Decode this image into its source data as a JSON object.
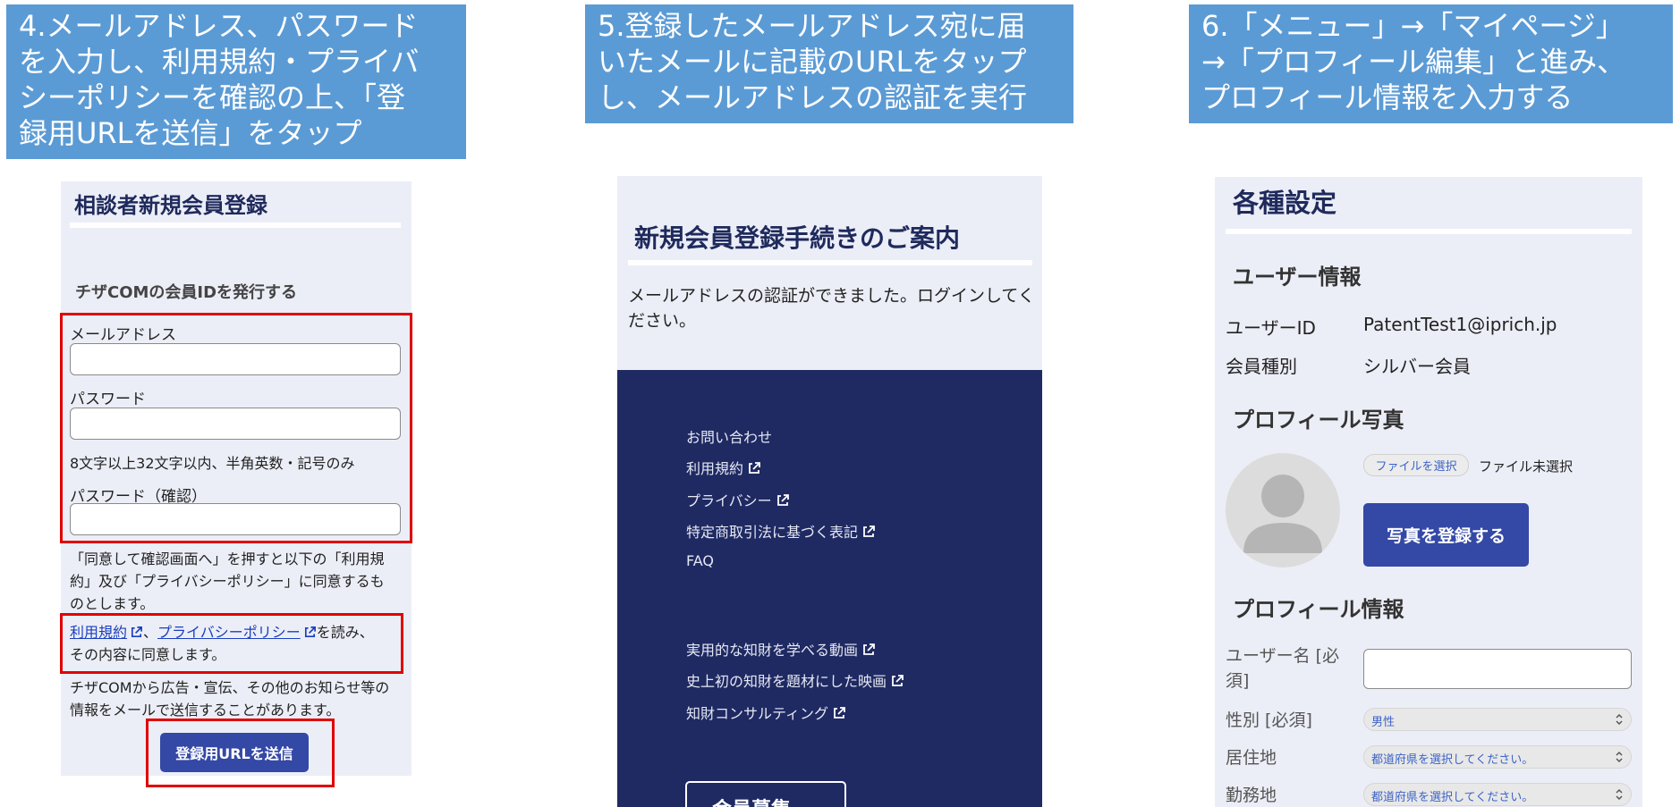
{
  "banners": {
    "step4": [
      "4.メールアドレス、パスワード",
      "を入力し、利用規約・プライバ",
      "シーポリシーを確認の上、「登",
      "録用URLを送信」をタップ"
    ],
    "step5": [
      "5.登録したメールアドレス宛に届",
      "いたメールに記載のURLをタップ",
      "し、メールアドレスの認証を実行"
    ],
    "step6": [
      "6.「メニュー」→「マイページ」",
      "→「プロフィール編集」と進み、",
      "プロフィール情報を入力する"
    ]
  },
  "register": {
    "title": "相談者新規会員登録",
    "subtitle": "チザCOMの会員IDを発行する",
    "email_label": "メールアドレス",
    "password_label": "パスワード",
    "password_hint": "8文字以上32文字以内、半角英数・記号のみ",
    "password_confirm_label": "パスワード（確認）",
    "consent_lines": [
      "「同意して確認画面へ」を押すと以下の「利用規",
      "約」及び「プライバシーポリシー」に同意するも",
      "のとします。"
    ],
    "terms_link": "利用規約",
    "separator": "、",
    "privacy_link": "プライバシーポリシー",
    "agree_tail": "を読み、",
    "agree_line2": "その内容に同意します。",
    "ads_lines": [
      "チザCOMから広告・宣伝、その他のお知らせ等の",
      "情報をメールで送信することがあります。"
    ],
    "submit_label": "登録用URLを送信"
  },
  "verify": {
    "title": "新規会員登録手続きのご案内",
    "message": "メールアドレスの認証ができました。ログインしてください。",
    "footer_links": [
      {
        "label": "お問い合わせ",
        "external": false
      },
      {
        "label": "利用規約",
        "external": true
      },
      {
        "label": "プライバシー",
        "external": true
      },
      {
        "label": "特定商取引法に基づく表記",
        "external": true
      },
      {
        "label": "FAQ",
        "external": false
      }
    ],
    "footer_links2": [
      {
        "label": "実用的な知財を学べる動画",
        "external": true
      },
      {
        "label": "史上初の知財を題材にした映画",
        "external": true
      },
      {
        "label": "知財コンサルティング",
        "external": true
      }
    ],
    "partial_button": "会員募集"
  },
  "settings": {
    "title": "各種設定",
    "user_section": "ユーザー情報",
    "user_id_label": "ユーザーID",
    "user_id_value": "PatentTest1@iprich.jp",
    "member_type_label": "会員種別",
    "member_type_value": "シルバー会員",
    "photo_section": "プロフィール写真",
    "file_button": "ファイルを選択",
    "file_none": "ファイル未選択",
    "photo_button": "写真を登録する",
    "profile_section": "プロフィール情報",
    "username_label": [
      "ユーザー名 [必",
      "須]"
    ],
    "gender_label": "性別 [必須]",
    "gender_value": "男性",
    "residence_label": "居住地",
    "residence_value": "都道府県を選択してください。",
    "work_label": "勤務地",
    "work_value": "都道府県を選択してください。"
  },
  "colors": {
    "banner": "#5b9bd5",
    "navy": "#1f2a63",
    "button": "#3448a6",
    "highlight": "#e00000",
    "link": "#1a3fbf"
  },
  "icons": {
    "external_link": "external-link-icon",
    "avatar": "user-avatar-icon",
    "select": "chevron-updown-icon"
  }
}
